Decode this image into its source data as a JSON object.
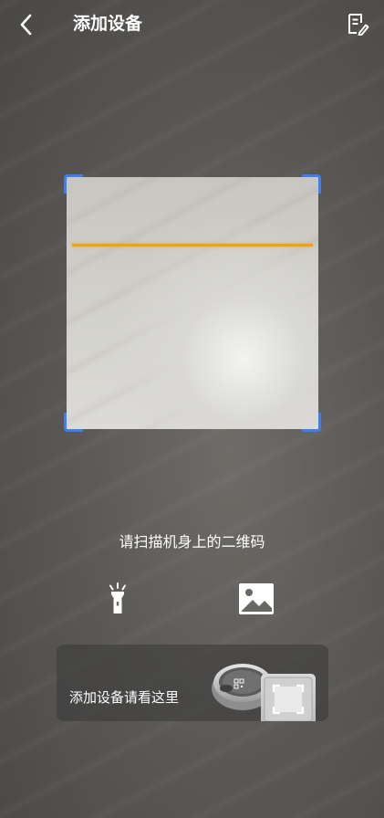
{
  "header": {
    "back_icon": "chevron-left-icon",
    "title": "添加设备",
    "manual_icon": "edit-note-icon"
  },
  "scanner": {
    "hint": "请扫描机身上的二维码",
    "corner_color": "#3d7ff0",
    "scan_line_color": "#f0a10f"
  },
  "tools": {
    "flashlight_icon": "flashlight-icon",
    "album_icon": "image-icon"
  },
  "guide_banner": {
    "text": "添加设备请看这里",
    "illustration": "robot-vacuum-qr-illustration"
  }
}
